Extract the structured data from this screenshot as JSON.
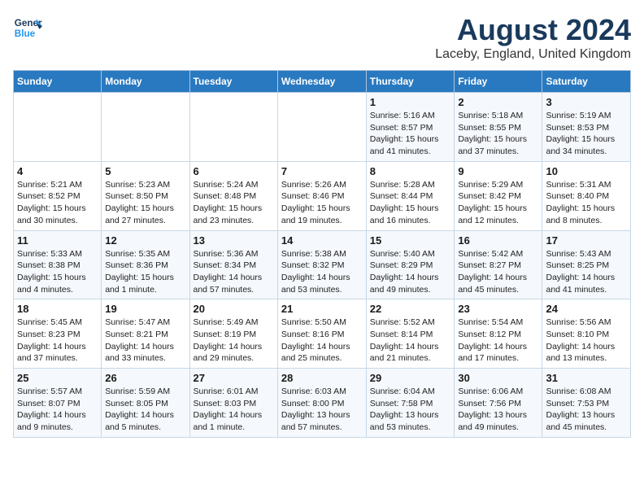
{
  "header": {
    "logo_line1": "General",
    "logo_line2": "Blue",
    "month_year": "August 2024",
    "location": "Laceby, England, United Kingdom"
  },
  "weekdays": [
    "Sunday",
    "Monday",
    "Tuesday",
    "Wednesday",
    "Thursday",
    "Friday",
    "Saturday"
  ],
  "weeks": [
    [
      {
        "day": "",
        "info": ""
      },
      {
        "day": "",
        "info": ""
      },
      {
        "day": "",
        "info": ""
      },
      {
        "day": "",
        "info": ""
      },
      {
        "day": "1",
        "info": "Sunrise: 5:16 AM\nSunset: 8:57 PM\nDaylight: 15 hours\nand 41 minutes."
      },
      {
        "day": "2",
        "info": "Sunrise: 5:18 AM\nSunset: 8:55 PM\nDaylight: 15 hours\nand 37 minutes."
      },
      {
        "day": "3",
        "info": "Sunrise: 5:19 AM\nSunset: 8:53 PM\nDaylight: 15 hours\nand 34 minutes."
      }
    ],
    [
      {
        "day": "4",
        "info": "Sunrise: 5:21 AM\nSunset: 8:52 PM\nDaylight: 15 hours\nand 30 minutes."
      },
      {
        "day": "5",
        "info": "Sunrise: 5:23 AM\nSunset: 8:50 PM\nDaylight: 15 hours\nand 27 minutes."
      },
      {
        "day": "6",
        "info": "Sunrise: 5:24 AM\nSunset: 8:48 PM\nDaylight: 15 hours\nand 23 minutes."
      },
      {
        "day": "7",
        "info": "Sunrise: 5:26 AM\nSunset: 8:46 PM\nDaylight: 15 hours\nand 19 minutes."
      },
      {
        "day": "8",
        "info": "Sunrise: 5:28 AM\nSunset: 8:44 PM\nDaylight: 15 hours\nand 16 minutes."
      },
      {
        "day": "9",
        "info": "Sunrise: 5:29 AM\nSunset: 8:42 PM\nDaylight: 15 hours\nand 12 minutes."
      },
      {
        "day": "10",
        "info": "Sunrise: 5:31 AM\nSunset: 8:40 PM\nDaylight: 15 hours\nand 8 minutes."
      }
    ],
    [
      {
        "day": "11",
        "info": "Sunrise: 5:33 AM\nSunset: 8:38 PM\nDaylight: 15 hours\nand 4 minutes."
      },
      {
        "day": "12",
        "info": "Sunrise: 5:35 AM\nSunset: 8:36 PM\nDaylight: 15 hours\nand 1 minute."
      },
      {
        "day": "13",
        "info": "Sunrise: 5:36 AM\nSunset: 8:34 PM\nDaylight: 14 hours\nand 57 minutes."
      },
      {
        "day": "14",
        "info": "Sunrise: 5:38 AM\nSunset: 8:32 PM\nDaylight: 14 hours\nand 53 minutes."
      },
      {
        "day": "15",
        "info": "Sunrise: 5:40 AM\nSunset: 8:29 PM\nDaylight: 14 hours\nand 49 minutes."
      },
      {
        "day": "16",
        "info": "Sunrise: 5:42 AM\nSunset: 8:27 PM\nDaylight: 14 hours\nand 45 minutes."
      },
      {
        "day": "17",
        "info": "Sunrise: 5:43 AM\nSunset: 8:25 PM\nDaylight: 14 hours\nand 41 minutes."
      }
    ],
    [
      {
        "day": "18",
        "info": "Sunrise: 5:45 AM\nSunset: 8:23 PM\nDaylight: 14 hours\nand 37 minutes."
      },
      {
        "day": "19",
        "info": "Sunrise: 5:47 AM\nSunset: 8:21 PM\nDaylight: 14 hours\nand 33 minutes."
      },
      {
        "day": "20",
        "info": "Sunrise: 5:49 AM\nSunset: 8:19 PM\nDaylight: 14 hours\nand 29 minutes."
      },
      {
        "day": "21",
        "info": "Sunrise: 5:50 AM\nSunset: 8:16 PM\nDaylight: 14 hours\nand 25 minutes."
      },
      {
        "day": "22",
        "info": "Sunrise: 5:52 AM\nSunset: 8:14 PM\nDaylight: 14 hours\nand 21 minutes."
      },
      {
        "day": "23",
        "info": "Sunrise: 5:54 AM\nSunset: 8:12 PM\nDaylight: 14 hours\nand 17 minutes."
      },
      {
        "day": "24",
        "info": "Sunrise: 5:56 AM\nSunset: 8:10 PM\nDaylight: 14 hours\nand 13 minutes."
      }
    ],
    [
      {
        "day": "25",
        "info": "Sunrise: 5:57 AM\nSunset: 8:07 PM\nDaylight: 14 hours\nand 9 minutes."
      },
      {
        "day": "26",
        "info": "Sunrise: 5:59 AM\nSunset: 8:05 PM\nDaylight: 14 hours\nand 5 minutes."
      },
      {
        "day": "27",
        "info": "Sunrise: 6:01 AM\nSunset: 8:03 PM\nDaylight: 14 hours\nand 1 minute."
      },
      {
        "day": "28",
        "info": "Sunrise: 6:03 AM\nSunset: 8:00 PM\nDaylight: 13 hours\nand 57 minutes."
      },
      {
        "day": "29",
        "info": "Sunrise: 6:04 AM\nSunset: 7:58 PM\nDaylight: 13 hours\nand 53 minutes."
      },
      {
        "day": "30",
        "info": "Sunrise: 6:06 AM\nSunset: 7:56 PM\nDaylight: 13 hours\nand 49 minutes."
      },
      {
        "day": "31",
        "info": "Sunrise: 6:08 AM\nSunset: 7:53 PM\nDaylight: 13 hours\nand 45 minutes."
      }
    ]
  ]
}
